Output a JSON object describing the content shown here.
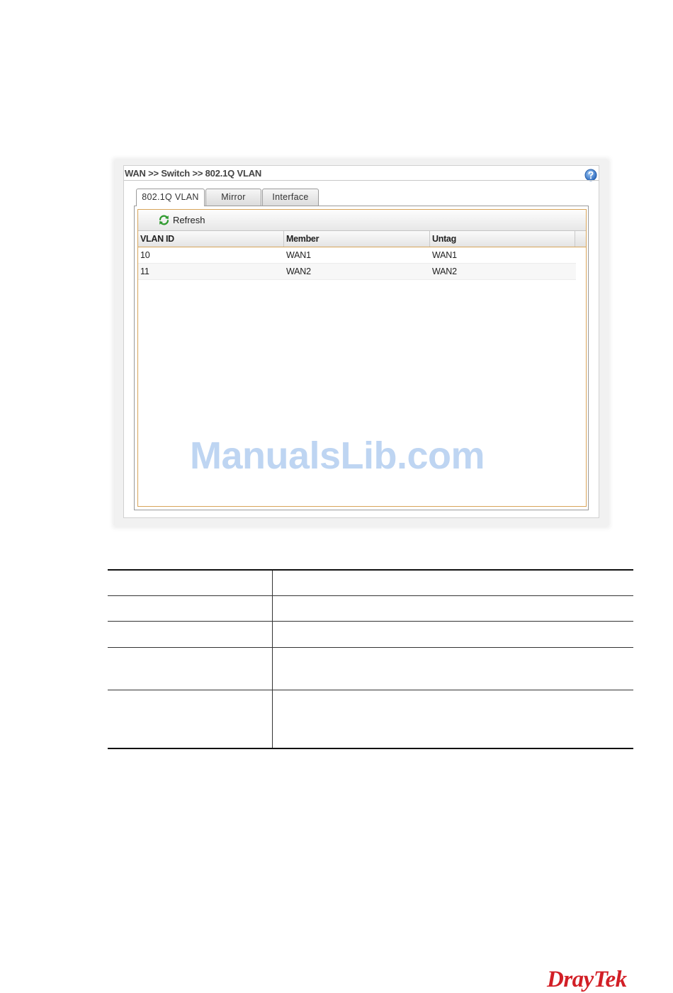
{
  "window": {
    "breadcrumb": "WAN >> Switch >> 802.1Q VLAN",
    "help_icon": "help-icon"
  },
  "tabs": [
    {
      "label": "802.1Q VLAN",
      "active": true
    },
    {
      "label": "Mirror",
      "active": false
    },
    {
      "label": "Interface",
      "active": false
    }
  ],
  "toolbar": {
    "refresh_label": "Refresh",
    "refresh_icon": "refresh-icon"
  },
  "table": {
    "columns": [
      "VLAN ID",
      "Member",
      "Untag"
    ],
    "rows": [
      {
        "vlan_id": "10",
        "member": "WAN1",
        "untag": "WAN1"
      },
      {
        "vlan_id": "11",
        "member": "WAN2",
        "untag": "WAN2"
      }
    ]
  },
  "watermark": "ManualsLib.com",
  "doc_table": {
    "row_count": 5
  },
  "logo": {
    "text": "DrayTek",
    "color": "#d21f26"
  },
  "colors": {
    "grid_border": "#d8a55a",
    "refresh_icon": "#2e9a2e",
    "help_icon": "#3a78c8"
  }
}
